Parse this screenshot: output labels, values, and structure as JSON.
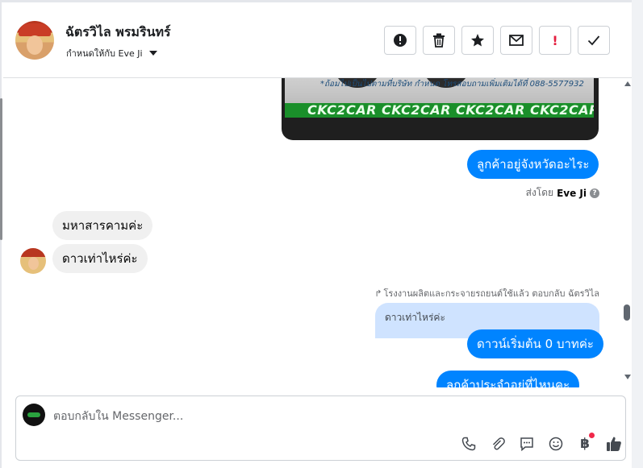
{
  "header": {
    "contact_name": "ฉัตรวิไล พรมรินทร์",
    "assign_label": "กำหนดให้กับ Eve Ji",
    "actions": [
      {
        "name": "report-spam-icon",
        "label": "!"
      },
      {
        "name": "trash-icon",
        "label": ""
      },
      {
        "name": "star-icon",
        "label": ""
      },
      {
        "name": "mail-icon",
        "label": ""
      },
      {
        "name": "follow-up-icon",
        "label": "!"
      },
      {
        "name": "checkmark-icon",
        "label": ""
      }
    ]
  },
  "chat": {
    "image_caption": "*ถ้อมไปเป็นไปตามที่บริษัท กำหนด โทรสอบถามเพิ่มเติมได้ที่ 088-5577932",
    "image_banner": "CKC2CAR CKC2CAR CKC2CAR CKC2CAR CKC2CAR CKC2",
    "messages": [
      {
        "direction": "out",
        "text": "ลูกค้าอยู่จังหวัดอะไระ"
      },
      {
        "direction": "in",
        "text": "มหาสารคามค่ะ"
      },
      {
        "direction": "in",
        "text": "ดาวเท่าไหร่ค่ะ"
      },
      {
        "direction": "out",
        "text": "ดาวน์เริ่มต้น 0 บาทค่ะ"
      },
      {
        "direction": "out",
        "text": "ลูกค้าประจำอยู่ที่ไหนคะ"
      }
    ],
    "sent_by_prefix": "ส่งโดย",
    "sent_by_name": "Eve Ji",
    "reply_note": "โรงงานผลิตและกระจายรถยนต์ใช้แล้ว ตอบกลับ ฉัตรวิไล",
    "reply_quote": "ดาวเท่าไหร่ค่ะ"
  },
  "composer": {
    "placeholder": "ตอบกลับใน Messenger...",
    "tools": [
      "phone-icon",
      "attachment-icon",
      "chat-bubble-icon",
      "emoji-icon",
      "baht-icon",
      "thumbs-up-icon"
    ],
    "baht_symbol": "฿"
  }
}
